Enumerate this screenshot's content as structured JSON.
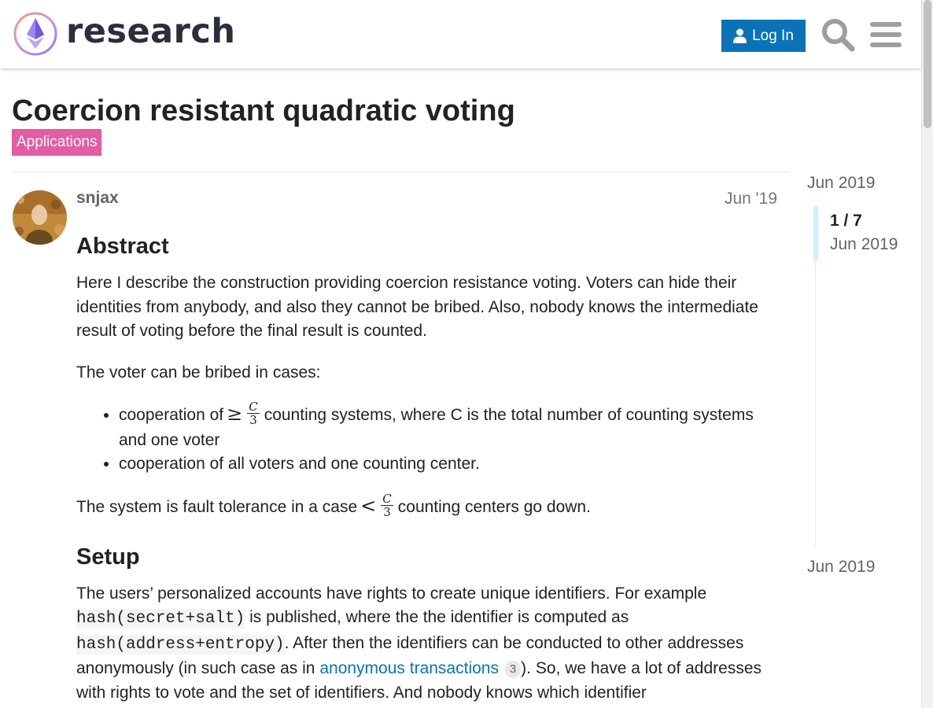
{
  "header": {
    "logo_text": "research",
    "login_label": "Log In"
  },
  "topic": {
    "title": "Coercion resistant quadratic voting",
    "category": "Applications",
    "category_color": "#e45ca4"
  },
  "post": {
    "username": "snjax",
    "date": "Jun '19",
    "abstract_heading": "Abstract",
    "abstract_text": "Here I describe the construction providing coercion resistance voting. Voters can hide their identities from anybody, and also they cannot be bribed. Also, nobody knows the intermediate result of voting before the final result is counted.",
    "bribe_intro": "The voter can be bribed in cases:",
    "bullet1_pre": "cooperation of",
    "bullet1_rel": "≥",
    "frac_num": "C",
    "frac_den": "3",
    "bullet1_post": "counting systems, where C is the total number of counting systems and one voter",
    "bullet2": "cooperation of all voters and one counting center.",
    "fault_pre": "The system is fault tolerance in a case",
    "fault_rel": "<",
    "fault_post": "counting centers go down.",
    "setup_heading": "Setup",
    "setup_text1": "The users’ personalized accounts have rights to create unique identifiers. For example",
    "code1": "hash(secret+salt)",
    "setup_text2": "is published, where the the identifier is computed as",
    "code2": "hash(address+entropy)",
    "setup_text3": ". After then the identifiers can be conducted to other addresses anonymously (in such case as in",
    "link_text": "anonymous transactions",
    "link_count": "3",
    "setup_text4": "). So, we have a lot of addresses with rights to vote and the set of identifiers. And nobody knows which identifier"
  },
  "timeline": {
    "start": "Jun 2019",
    "position": "1 / 7",
    "position_date": "Jun 2019",
    "end": "Jun 2019"
  },
  "colors": {
    "accent": "#0a73b8",
    "timeline_handle": "#d1f0ff"
  }
}
